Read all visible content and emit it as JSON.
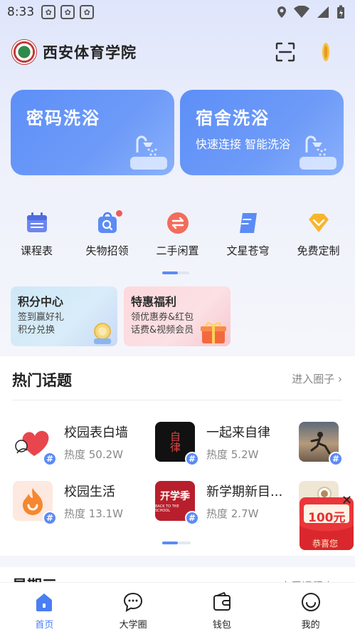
{
  "status_bar": {
    "time": "8:33"
  },
  "header": {
    "school_name": "西安体育学院"
  },
  "service_cards": [
    {
      "title": "密码洗浴",
      "subtitle": ""
    },
    {
      "title": "宿舍洗浴",
      "subtitle": "快速连接 智能洗浴"
    }
  ],
  "quick_entries": [
    {
      "label": "课程表",
      "icon": "calendar-icon"
    },
    {
      "label": "失物招领",
      "icon": "lost-found-icon"
    },
    {
      "label": "二手闲置",
      "icon": "exchange-icon"
    },
    {
      "label": "文星苍穹",
      "icon": "document-icon"
    },
    {
      "label": "免费定制",
      "icon": "diamond-icon"
    }
  ],
  "promos": {
    "points": {
      "title": "积分中心",
      "line1": "签到赢好礼",
      "line2": "积分兑换"
    },
    "welfare": {
      "title": "特惠福利",
      "line1": "领优惠券&红包",
      "line2": "话费&视频会员"
    }
  },
  "topics_section": {
    "title": "热门话题",
    "more_label": "进入圈子",
    "topics": [
      {
        "name": "校园表白墙",
        "heat": "热度  50.2W"
      },
      {
        "name": "一起来自律",
        "heat": "热度  5.2W"
      },
      {
        "name": "校园生活",
        "heat": "热度  13.1W"
      },
      {
        "name": "新学期新目...",
        "heat": "热度  2.7W"
      }
    ],
    "thumb_text": {
      "discipline": "自律",
      "semester": "开学季",
      "semester_sub": "BACK TO THE SCHOOL"
    }
  },
  "coupon": {
    "amount": "100元",
    "caption": "恭喜您"
  },
  "next_section": {
    "title": "星期三",
    "more_label": "本周课程表"
  },
  "tabbar": [
    {
      "label": "首页",
      "active": true
    },
    {
      "label": "大学圈",
      "active": false
    },
    {
      "label": "钱包",
      "active": false
    },
    {
      "label": "我的",
      "active": false
    }
  ],
  "colors": {
    "accent": "#4a7ef3",
    "card_blue": "#6e9bf8",
    "badge_red": "#ee5b5b"
  }
}
